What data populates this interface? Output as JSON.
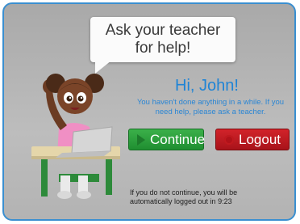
{
  "bubble": {
    "line1": "Ask your teacher",
    "line2": "for help!"
  },
  "greeting": "Hi, John!",
  "message": "You haven't done anything in a while. If you need help, please ask a teacher.",
  "buttons": {
    "continue_label": "Continue",
    "logout_label": "Logout"
  },
  "footer": {
    "line1": "If you do not continue, you will be",
    "line2": "automatically logged out in 9:23"
  },
  "colors": {
    "border": "#3a8fd0",
    "greeting_text": "#1f84d6",
    "continue": "#2ea03e",
    "logout": "#c0191f"
  },
  "icons": {
    "continue": "play-icon",
    "logout": "power-icon"
  }
}
